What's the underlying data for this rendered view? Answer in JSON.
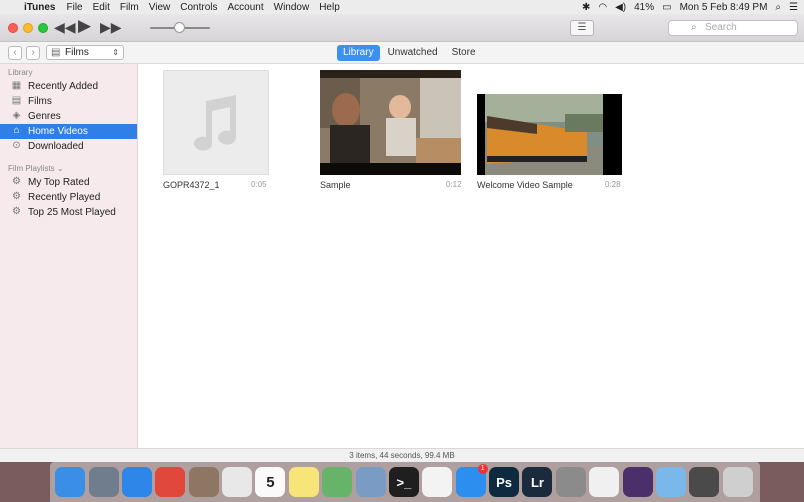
{
  "menubar": {
    "app_name": "iTunes",
    "menus": [
      "File",
      "Edit",
      "Film",
      "View",
      "Controls",
      "Account",
      "Window",
      "Help"
    ],
    "battery": "41%",
    "datetime": "Mon 5 Feb  8:49 PM"
  },
  "toolbar": {
    "search_placeholder": "Search"
  },
  "navbar": {
    "media_kind": "Films",
    "tabs": [
      {
        "label": "Library",
        "active": true
      },
      {
        "label": "Unwatched",
        "active": false
      },
      {
        "label": "Store",
        "active": false
      }
    ]
  },
  "sidebar": {
    "library_heading": "Library",
    "library_items": [
      {
        "label": "Recently Added",
        "icon": "grid-icon"
      },
      {
        "label": "Films",
        "icon": "film-icon"
      },
      {
        "label": "Genres",
        "icon": "genres-icon"
      },
      {
        "label": "Home Videos",
        "icon": "home-video-icon",
        "selected": true
      },
      {
        "label": "Downloaded",
        "icon": "download-icon"
      }
    ],
    "playlists_heading": "Film Playlists ⌄",
    "playlist_items": [
      {
        "label": "My Top Rated",
        "icon": "gear-icon"
      },
      {
        "label": "Recently Played",
        "icon": "gear-icon"
      },
      {
        "label": "Top 25 Most Played",
        "icon": "gear-icon"
      }
    ]
  },
  "videos": [
    {
      "title": "GOPR4372_1",
      "duration": "0:05"
    },
    {
      "title": "Sample",
      "duration": "0:12"
    },
    {
      "title": "Welcome Video Sample",
      "duration": "0:28"
    }
  ],
  "status": "3 items, 44 seconds, 99.4 MB",
  "dock": {
    "apps": [
      {
        "name": "finder-icon",
        "color": "#3a8ee6"
      },
      {
        "name": "launchpad-icon",
        "color": "#6f7d8c"
      },
      {
        "name": "safari-icon",
        "color": "#2d86e8"
      },
      {
        "name": "chrome-icon",
        "color": "#e0483c"
      },
      {
        "name": "calculator-icon",
        "color": "#8d7762"
      },
      {
        "name": "textedit-icon",
        "color": "#e8e8e8"
      },
      {
        "name": "calendar-icon",
        "color": "#fafafa",
        "text": "5"
      },
      {
        "name": "notes-icon",
        "color": "#f7e57a"
      },
      {
        "name": "maps-icon",
        "color": "#67b36a"
      },
      {
        "name": "preview-icon",
        "color": "#7a9cc4"
      },
      {
        "name": "terminal-icon",
        "color": "#1f1f1f",
        "text": ">_"
      },
      {
        "name": "photos-icon",
        "color": "#f3f3f3"
      },
      {
        "name": "app-store-icon",
        "color": "#2c8ff0",
        "badge": "1"
      },
      {
        "name": "photoshop-icon",
        "color": "#0d2a3f",
        "text": "Ps"
      },
      {
        "name": "lightroom-icon",
        "color": "#1b2b3d",
        "text": "Lr"
      },
      {
        "name": "system-preferences-icon",
        "color": "#8b8b8b"
      },
      {
        "name": "itunes-icon",
        "color": "#f0f0f0"
      },
      {
        "name": "media-encoder-icon",
        "color": "#4a2f6b"
      },
      {
        "name": "folder-icon",
        "color": "#7ab8ec"
      },
      {
        "name": "downloads-stack-icon",
        "color": "#4a4a4a"
      },
      {
        "name": "trash-icon",
        "color": "#cfcfcf"
      }
    ]
  }
}
